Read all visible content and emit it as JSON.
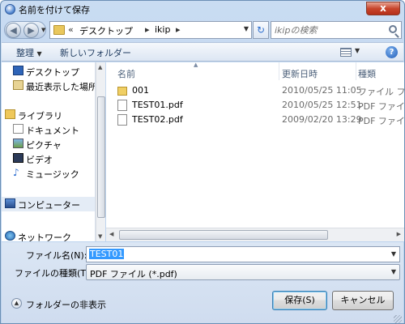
{
  "window": {
    "title": "名前を付けて保存",
    "close_label": "x"
  },
  "address": {
    "prefix": "«",
    "crumbs": [
      "デスクトップ",
      "ikip"
    ],
    "sep": "▸"
  },
  "search": {
    "placeholder": "ikipの検索"
  },
  "toolbar": {
    "organize": "整理",
    "new_folder": "新しいフォルダー",
    "help": "?"
  },
  "nav": {
    "items": [
      {
        "label": "デスクトップ",
        "icon": "desktop-icon"
      },
      {
        "label": "最近表示した場所",
        "icon": "recent-places-icon"
      },
      {
        "label": "ライブラリ",
        "icon": "library-icon"
      },
      {
        "label": "ドキュメント",
        "icon": "documents-icon"
      },
      {
        "label": "ピクチャ",
        "icon": "pictures-icon"
      },
      {
        "label": "ビデオ",
        "icon": "videos-icon"
      },
      {
        "label": "ミュージック",
        "icon": "music-icon"
      },
      {
        "label": "コンピューター",
        "icon": "computer-icon"
      },
      {
        "label": "ネットワーク",
        "icon": "network-icon"
      }
    ]
  },
  "files": {
    "columns": {
      "name": "名前",
      "date": "更新日時",
      "type": "種類"
    },
    "rows": [
      {
        "name": "001",
        "date": "2010/05/25 11:05",
        "type": "ファイル フ",
        "kind": "folder"
      },
      {
        "name": "TEST01.pdf",
        "date": "2010/05/25 12:51",
        "type": "PDF ファイ",
        "kind": "file"
      },
      {
        "name": "TEST02.pdf",
        "date": "2009/02/20 13:29",
        "type": "PDF ファイ",
        "kind": "file"
      }
    ]
  },
  "form": {
    "filename_label": "ファイル名(N):",
    "filename_value": "TEST01",
    "filetype_label": "ファイルの種類(T):",
    "filetype_value": "PDF ファイル (*.pdf)"
  },
  "footer": {
    "toggle_folders": "フォルダーの非表示",
    "save": "保存(S)",
    "cancel": "キャンセル"
  },
  "colors": {
    "accent": "#3399ff",
    "titlebar": "#c9dcf2",
    "close": "#c8462c"
  }
}
